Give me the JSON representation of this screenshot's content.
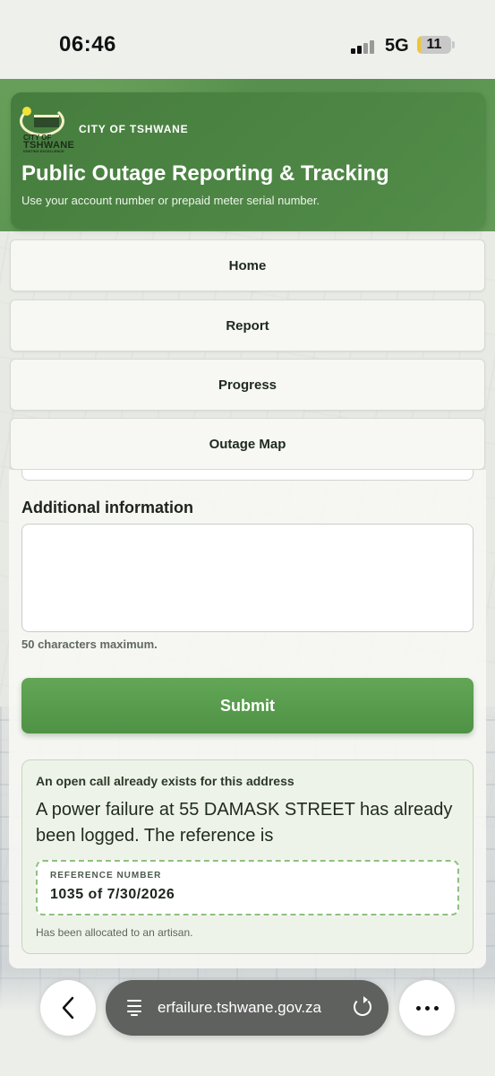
{
  "status_bar": {
    "time": "06:46",
    "network": "5G",
    "battery": "11",
    "battery_level": 0.11
  },
  "header": {
    "logo_text": [
      "CITY OF",
      "TSHWANE",
      "IGNITING EXCELLENCE"
    ],
    "org_name": "CITY OF TSHWANE",
    "title": "Public Outage Reporting & Tracking",
    "subtitle": "Use your account number or prepaid meter serial number."
  },
  "nav": {
    "items": [
      {
        "label": "Home"
      },
      {
        "label": "Report"
      },
      {
        "label": "Progress"
      },
      {
        "label": "Outage Map"
      }
    ]
  },
  "form": {
    "additional_info_label": "Additional information",
    "additional_info_value": "",
    "hint": "50 characters maximum.",
    "submit_label": "Submit"
  },
  "alert": {
    "title": "An open call already exists for this address",
    "message": "A power failure at 55 DAMASK STREET has already been logged. The reference is",
    "reference_label": "REFERENCE NUMBER",
    "reference_value": "1035 of 7/30/2026",
    "footer": "Has been allocated to an artisan."
  },
  "browser": {
    "url": "erfailure.tshwane.gov.za",
    "icons": [
      "back-arrow-icon",
      "page-icon",
      "reload-icon",
      "more-dots-icon"
    ]
  },
  "colors": {
    "brand_green": "#4f9245",
    "header_green": "#437a3c",
    "alert_border": "#c3d6bc",
    "dashed_border": "#8fc07f"
  }
}
